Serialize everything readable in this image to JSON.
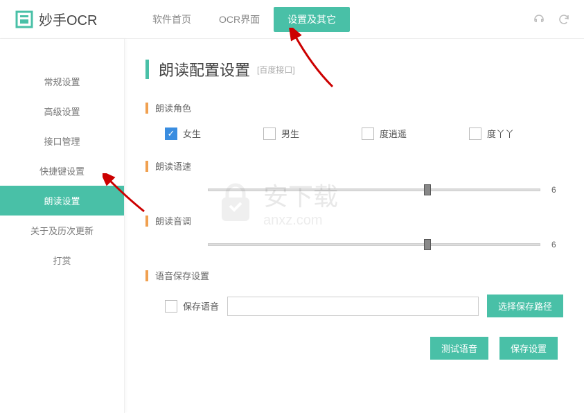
{
  "app": {
    "name": "妙手OCR"
  },
  "nav": {
    "items": [
      "软件首页",
      "OCR界面",
      "设置及其它"
    ],
    "activeIndex": 2
  },
  "sidebar": {
    "items": [
      "常规设置",
      "高级设置",
      "接口管理",
      "快捷键设置",
      "朗读设置",
      "关于及历次更新",
      "打赏"
    ],
    "activeIndex": 4
  },
  "page": {
    "title": "朗读配置设置",
    "titleNote": "[百度接口]"
  },
  "sections": {
    "voice": {
      "label": "朗读角色",
      "options": [
        "女生",
        "男生",
        "度逍遥",
        "度丫丫"
      ],
      "selectedIndex": 0
    },
    "speed": {
      "label": "朗读语速",
      "value": "6",
      "thumbPercent": 65
    },
    "pitch": {
      "label": "朗读音调",
      "value": "6",
      "thumbPercent": 65
    },
    "save": {
      "label": "语音保存设置",
      "checkbox": "保存语音",
      "path": "",
      "choose": "选择保存路径"
    }
  },
  "buttons": {
    "test": "测试语音",
    "save": "保存设置"
  },
  "watermark": {
    "text": "安下载",
    "sub": "anxz.com"
  }
}
